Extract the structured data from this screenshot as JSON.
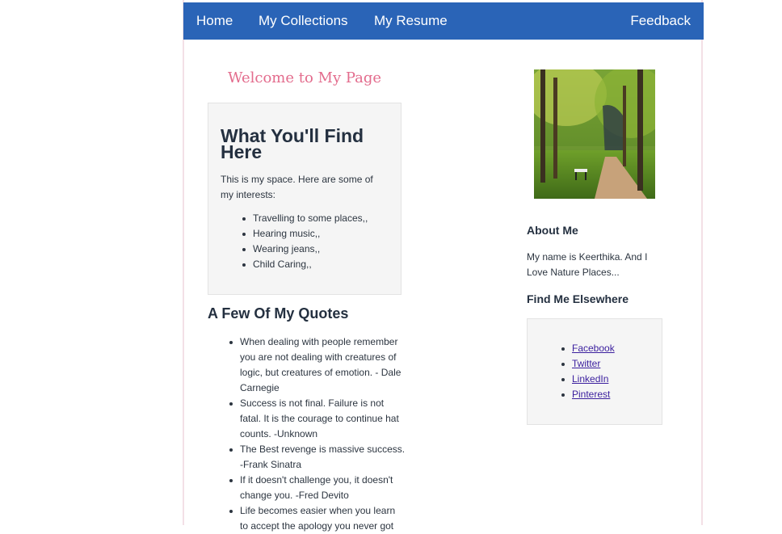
{
  "nav": {
    "home": "Home",
    "collections": "My Collections",
    "resume": "My Resume",
    "feedback": "Feedback"
  },
  "welcome": "Welcome to My Page",
  "interests_box": {
    "title": "What You'll Find Here",
    "intro": "This is my space. Here are some of my interests:",
    "items": [
      "Travelling to some places,,",
      "Hearing music,,",
      "Wearing jeans,,",
      "Child Caring,,"
    ]
  },
  "quotes": {
    "title": "A Few Of My Quotes",
    "items": [
      "When dealing with people remember you are not dealing with creatures of logic, but creatures of emotion. - Dale Carnegie",
      "Success is not final. Failure is not fatal. It is the courage to continue hat counts. -Unknown",
      "The Best revenge is massive success. -Frank Sinatra",
      "If it doesn't challenge you, it doesn't change you. -Fred Devito",
      "Life becomes easier when you learn to accept the apology you never got"
    ]
  },
  "about": {
    "title": "About Me",
    "text": "My name is Keerthika. And I Love Nature Places..."
  },
  "elsewhere": {
    "title": "Find Me Elsewhere",
    "links": [
      "Facebook",
      "Twitter",
      "LinkedIn",
      "Pinterest"
    ]
  },
  "colors": {
    "navbar": "#2a64b7",
    "welcome": "#e36c8d",
    "link": "#3b1f9e"
  }
}
